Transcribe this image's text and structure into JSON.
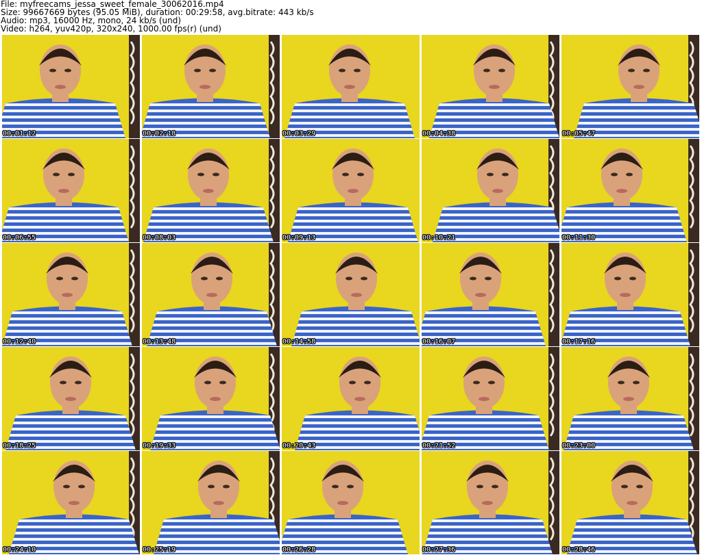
{
  "header": {
    "line1": "File: myfreecams_jessa_sweet_female_30062016.mp4",
    "line2": "Size: 99667669 bytes (95.05 MiB), duration: 00:29:58, avg.bitrate: 443 kb/s",
    "line3": "Audio: mp3, 16000 Hz, mono, 24 kb/s (und)",
    "line4": "Video: h264, yuv420p, 320x240, 1000.00 fps(r) (und)"
  },
  "thumbnails": [
    {
      "timestamp": "00:01:12"
    },
    {
      "timestamp": "00:02:18"
    },
    {
      "timestamp": "00:03:29"
    },
    {
      "timestamp": "00:04:38"
    },
    {
      "timestamp": "00:05:47"
    },
    {
      "timestamp": "00:06:55"
    },
    {
      "timestamp": "00:08:03"
    },
    {
      "timestamp": "00:09:13"
    },
    {
      "timestamp": "00:10:21"
    },
    {
      "timestamp": "00:11:30"
    },
    {
      "timestamp": "00:12:40"
    },
    {
      "timestamp": "00:13:48"
    },
    {
      "timestamp": "00:14:58"
    },
    {
      "timestamp": "00:16:07"
    },
    {
      "timestamp": "00:17:16"
    },
    {
      "timestamp": "00:18:25"
    },
    {
      "timestamp": "00:19:33"
    },
    {
      "timestamp": "00:20:43"
    },
    {
      "timestamp": "00:21:52"
    },
    {
      "timestamp": "00:23:00"
    },
    {
      "timestamp": "00:24:10"
    },
    {
      "timestamp": "00:25:19"
    },
    {
      "timestamp": "00:26:28"
    },
    {
      "timestamp": "00:27:36"
    },
    {
      "timestamp": "00:28:46"
    }
  ],
  "colors": {
    "background_wall": "#e8d61f",
    "shirt_blue": "#3a64c8",
    "shirt_stripe": "#f2f4fb",
    "skin": "#d9a27a",
    "hair": "#2b1d14",
    "curtain_dark": "#3a2a22",
    "curtain_light": "#efe6da"
  }
}
